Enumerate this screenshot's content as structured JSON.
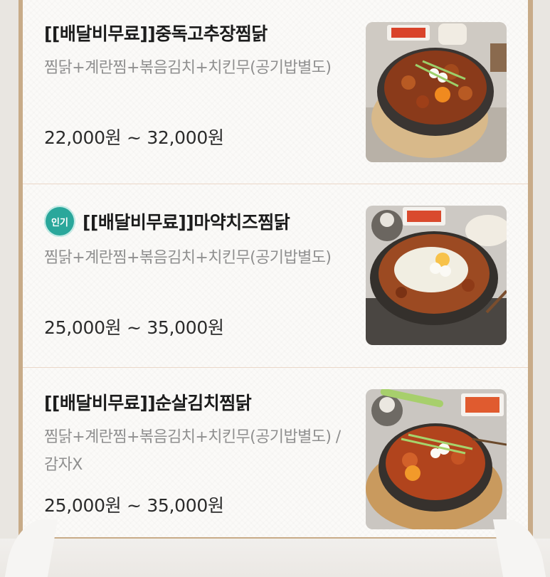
{
  "menu": {
    "items": [
      {
        "title": "[[배달비무료]]중독고추장찜닭",
        "description": "찜닭+계란찜+볶음김치+치킨무(공기밥별도)",
        "price": "22,000원 ~ 32,000원",
        "badge": "",
        "image_icon": "spicy-braised-chicken-image"
      },
      {
        "title": "[[배달비무료]]마약치즈찜닭",
        "description": "찜닭+계란찜+볶음김치+치킨무(공기밥별도)",
        "price": "25,000원 ~ 35,000원",
        "badge": "인기",
        "image_icon": "cheese-braised-chicken-image"
      },
      {
        "title": "[[배달비무료]]순살김치찜닭",
        "description": "찜닭+계란찜+볶음김치+치킨무(공기밥별도) / 감자X",
        "price": "25,000원 ~ 35,000원",
        "badge": "",
        "image_icon": "kimchi-braised-chicken-image"
      }
    ]
  },
  "colors": {
    "badge": "#2aa79b",
    "frame": "#c8ab88",
    "divider": "#ead7c8"
  }
}
